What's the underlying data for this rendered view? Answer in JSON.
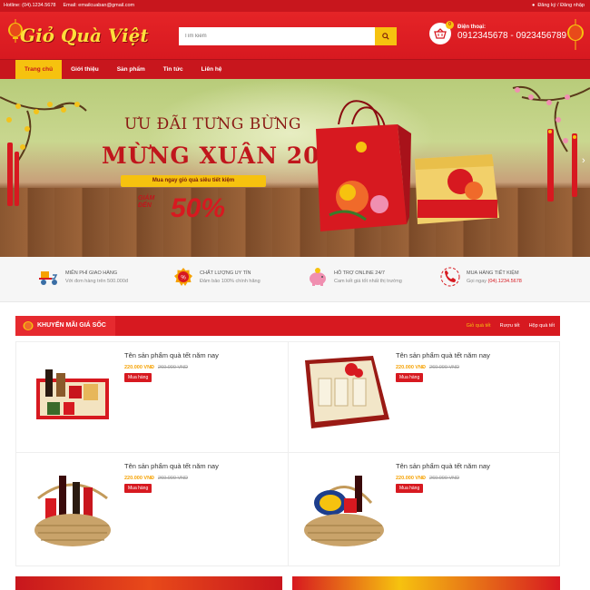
{
  "topbar": {
    "hotline": "Hotline: (04).1234.5678",
    "email": "Email: emailcuaban@gmail.com",
    "auth": "Đăng ký / Đăng nhập"
  },
  "header": {
    "logo": "Giỏ Quà Việt",
    "search_placeholder": "Tìm kiếm",
    "cart_count": "0",
    "phone_label": "Điện thoại:",
    "phone_numbers": "0912345678 - 0923456789"
  },
  "nav": {
    "items": [
      "Trang chủ",
      "Giới thiệu",
      "Sản phẩm",
      "Tin tức",
      "Liên hệ"
    ],
    "active": "Trang chủ"
  },
  "banner": {
    "line1": "ƯU ĐÃI TƯNG BỪNG",
    "line2": "MỪNG XUÂN 2018",
    "ribbon": "Mua ngay giỏ quà siêu tiết kiệm",
    "sale_label_1": "GIẢM",
    "sale_label_2": "ĐẾN",
    "sale_pct": "50%",
    "next_arrow": "›"
  },
  "features": [
    {
      "icon": "delivery-scooter-icon",
      "title": "Miễn phí giao hàng",
      "desc": "Với đơn hàng trên 500.000đ",
      "highlight": ""
    },
    {
      "icon": "quality-badge-icon",
      "title": "Chất lượng uy tín",
      "desc": "Đảm bảo 100% chính hãng",
      "highlight": ""
    },
    {
      "icon": "piggy-bank-icon",
      "title": "Hỗ trợ online 24/7",
      "desc": "Cam kết giá tốt nhất thị trường",
      "highlight": ""
    },
    {
      "icon": "phone-support-icon",
      "title": "Mua hàng tiết kiệm",
      "desc": "Gọi ngay ",
      "highlight": "(04).1234.5678"
    }
  ],
  "promo": {
    "title": "KHUYẾN MÃI GIÁ SỐC",
    "tabs": [
      "Giỏ quà tết",
      "Rượu tết",
      "Hộp quà tết"
    ],
    "active_tab": "Giỏ quà tết",
    "products": [
      {
        "name": "Tên sản phẩm quà tết năm nay",
        "price": "220.000 VNĐ",
        "old_price": "260.000 VNĐ",
        "buy": "Mua hàng"
      },
      {
        "name": "Tên sản phẩm quà tết năm nay",
        "price": "220.000 VNĐ",
        "old_price": "260.000 VNĐ",
        "buy": "Mua hàng"
      },
      {
        "name": "Tên sản phẩm quà tết năm nay",
        "price": "220.000 VNĐ",
        "old_price": "260.000 VNĐ",
        "buy": "Mua hàng"
      },
      {
        "name": "Tên sản phẩm quà tết năm nay",
        "price": "220.000 VNĐ",
        "old_price": "260.000 VNĐ",
        "buy": "Mua hàng"
      }
    ]
  },
  "colors": {
    "brand_red": "#d71920",
    "accent_yellow": "#f6c20f",
    "price_orange": "#f6a100"
  }
}
